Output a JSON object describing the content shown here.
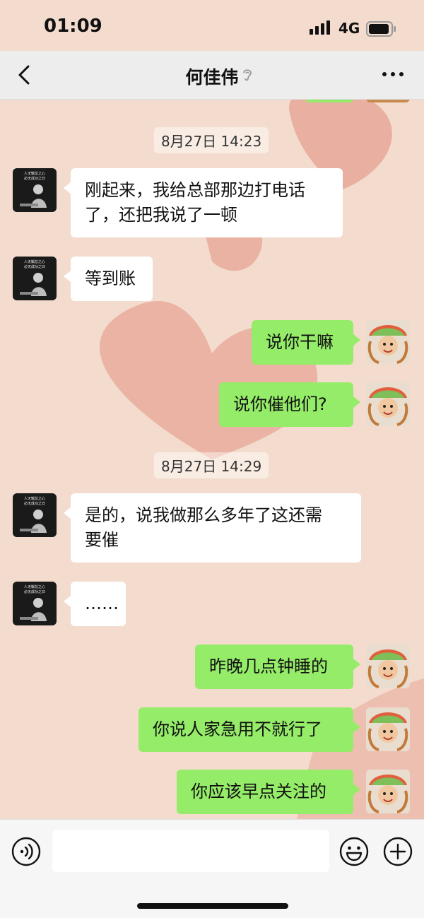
{
  "status_bar": {
    "time": "01:09",
    "network": "4G"
  },
  "header": {
    "title": "何佳伟"
  },
  "messages": [
    {
      "type": "timestamp",
      "text": "8月27日 14:23"
    },
    {
      "type": "in",
      "line1": "刚起来，我给总部那边打电话",
      "line2": "了，还把我说了一顿"
    },
    {
      "type": "in",
      "text": "等到账"
    },
    {
      "type": "out",
      "text": "说你干嘛"
    },
    {
      "type": "out",
      "text": "说你催他们?"
    },
    {
      "type": "timestamp",
      "text": "8月27日 14:29"
    },
    {
      "type": "in",
      "line1": "是的，说我做那么多年了这还需",
      "line2": "要催"
    },
    {
      "type": "in",
      "text": "……"
    },
    {
      "type": "out",
      "text": "昨晚几点钟睡的"
    },
    {
      "type": "out",
      "text": "你说人家急用不就行了"
    },
    {
      "type": "out",
      "text": "你应该早点关注的"
    }
  ],
  "avatar_text": {
    "line1": "人无懈怠之心",
    "line2": "必无成功之日"
  },
  "colors": {
    "outgoing_bubble": "#95ec69",
    "incoming_bubble": "#ffffff",
    "nav_bg": "#ededed",
    "chat_bg": "#f2d8c9"
  }
}
